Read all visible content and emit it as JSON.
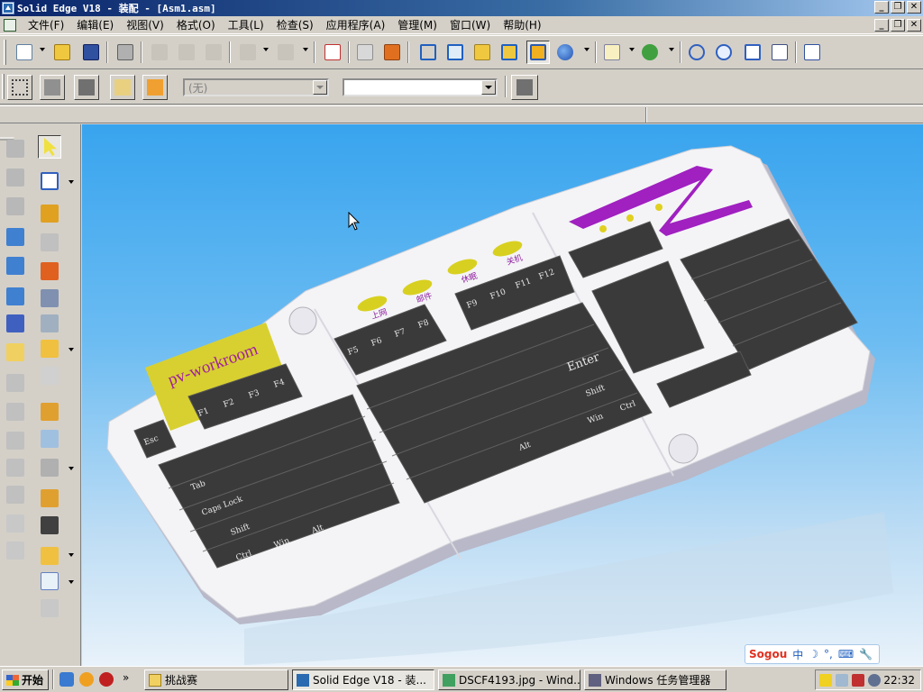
{
  "window": {
    "title": "Solid Edge V18 - 装配 - [Asm1.asm]"
  },
  "menu": {
    "items": [
      "文件(F)",
      "编辑(E)",
      "视图(V)",
      "格式(O)",
      "工具(L)",
      "检查(S)",
      "应用程序(A)",
      "管理(M)",
      "窗口(W)",
      "帮助(H)"
    ]
  },
  "toolbar2": {
    "style_combo_value": "(无)",
    "second_combo_value": ""
  },
  "keyboard_model": {
    "brand_label": "pv-workroom",
    "indicator_labels": [
      "上网",
      "邮件",
      "休眠",
      "关机"
    ],
    "keys": {
      "esc": "Esc",
      "f1": "F1",
      "f2": "F2",
      "f3": "F3",
      "f4": "F4",
      "f5": "F5",
      "f6": "F6",
      "f7": "F7",
      "f8": "F8",
      "f9": "F9",
      "f10": "F10",
      "f11": "F11",
      "f12": "F12",
      "tab": "Tab",
      "caps": "Caps Lock",
      "shift_l": "Shift",
      "ctrl_l": "Ctrl",
      "win_l": "Win",
      "alt_l": "Alt",
      "alt_r": "Alt",
      "win_r": "Win",
      "ctrl_r": "Ctrl",
      "shift_r": "Shift",
      "enter": "Enter"
    }
  },
  "ime": {
    "logo": "Sogou",
    "mode": "中"
  },
  "taskbar": {
    "start_label": "开始",
    "folder_task": "挑战赛",
    "tasks": [
      "Solid Edge V18 - 装...",
      "DSCF4193.jpg - Wind...",
      "Windows 任务管理器"
    ],
    "clock": "22:32"
  }
}
